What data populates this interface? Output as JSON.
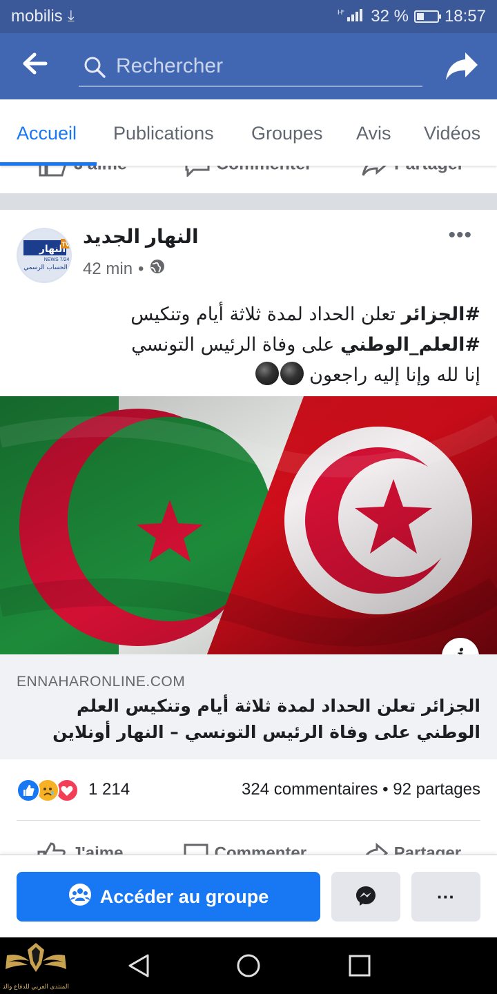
{
  "status_bar": {
    "carrier": "mobilis",
    "network": "H⁺",
    "battery": "32 %",
    "time": "18:57"
  },
  "search": {
    "placeholder": "Rechercher"
  },
  "tabs": [
    {
      "label": "Accueil",
      "active": true
    },
    {
      "label": "Publications",
      "active": false
    },
    {
      "label": "Groupes",
      "active": false
    },
    {
      "label": "Avis",
      "active": false
    },
    {
      "label": "Vidéos",
      "active": false
    }
  ],
  "previous_post_actions": [
    "J'aime",
    "Commenter",
    "Partager"
  ],
  "post": {
    "author": "النهار الجديد",
    "time": "42 min",
    "more_label": "•••",
    "avatar_text": [
      "النهار",
      "NEWS 7/24",
      "الحساب الرسمي",
      "TV"
    ],
    "text_line1_hashtag": "#الجزائر",
    "text_line1_rest": " تعلن الحداد لمدة ثلاثة أيام وتنكيس",
    "text_line2_hashtag": "#العلم_الوطني",
    "text_line2_rest": " على وفاة الرئيس التونسي",
    "text_line3": "إنا لله وإنا إليه راجعون ",
    "info_label": "i",
    "link": {
      "domain": "ENNAHARONLINE.COM",
      "title": "الجزائر تعلن الحداد لمدة ثلاثة أيام وتنكيس العلم الوطني على وفاة الرئيس التونسي – النهار أونلاين"
    },
    "reactions_count": "1 214",
    "comments": "324 commentaires",
    "stats_separator": "•",
    "shares": "92 partages",
    "actions": {
      "like": "J'aime",
      "comment": "Commenter",
      "share": "Partager"
    }
  },
  "bottom_bar": {
    "join_label": "Accéder au groupe",
    "more_label": "···"
  },
  "watermark": {
    "text": "المنتدى العربي للدفاع والتسليح"
  },
  "colors": {
    "status_bar": "#3b5998",
    "header": "#4267b2",
    "accent": "#1877f2",
    "algeria_green": "#1d8a3a",
    "flag_red": "#d21034"
  }
}
